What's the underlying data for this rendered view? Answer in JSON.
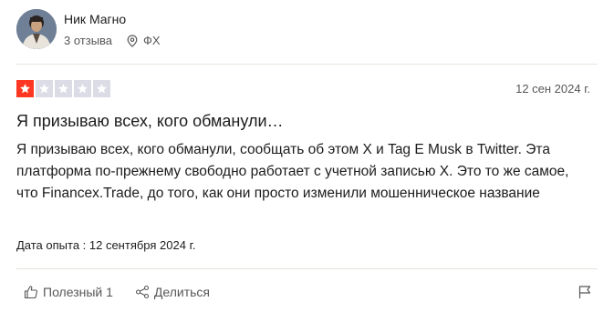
{
  "reviewer": {
    "name": "Ник Магно",
    "reviews_count": "3 отзыва",
    "country": "ФХ"
  },
  "rating": {
    "value": 1,
    "max": 5,
    "active_color": "#ff3722",
    "inactive_color": "#dcdce6"
  },
  "review": {
    "date": "12 сен 2024 г.",
    "title": "Я призываю всех, кого обманули…",
    "body": "Я призываю всех, кого обманули, сообщать об этом X и Tag E Musk в Twitter. Эта платформа по-прежнему свободно работает с учетной записью X. Это то же самое, что Financex.Trade, до того, как они просто изменили мошенническое название",
    "experience": "Дата опыта : 12 сентября 2024 г."
  },
  "actions": {
    "useful_label": "Полезный 1",
    "share_label": "Делиться",
    "useful_icon": "thumbs-up-icon",
    "share_icon": "share-icon",
    "report_icon": "flag-icon"
  }
}
